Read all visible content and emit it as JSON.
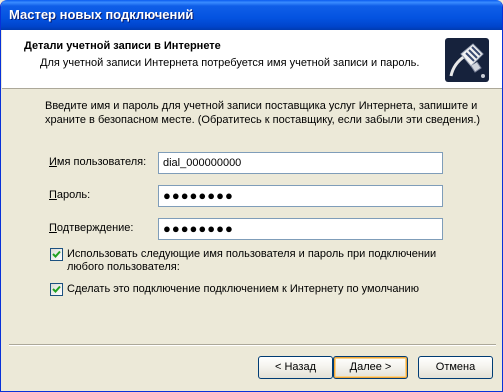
{
  "window": {
    "title": "Мастер новых подключений"
  },
  "header": {
    "title": "Детали учетной записи в Интернете",
    "subtitle": "Для учетной записи Интернета потребуется имя учетной записи и пароль."
  },
  "intro": "Введите имя и пароль для учетной записи поставщика услуг Интернета, запишите и храните в безопасном месте. (Обратитесь к поставщику, если забыли эти сведения.)",
  "form": {
    "username_label": "Имя пользователя:",
    "username_value": "dial_000000000",
    "password_label": "Пароль:",
    "password_value": "●●●●●●●●",
    "confirm_label": "Подтверждение:",
    "confirm_value": "●●●●●●●●",
    "checkbox1_label": "Использовать следующие имя пользователя и пароль при подключении любого пользователя:",
    "checkbox1_checked": true,
    "checkbox2_label": "Сделать это подключение подключением к Интернету по умолчанию",
    "checkbox2_checked": true
  },
  "buttons": {
    "back": "< Назад",
    "next": "Далее >",
    "cancel": "Отмена"
  },
  "icons": {
    "header": "phone-plug-icon",
    "check": "checkmark-icon"
  },
  "colors": {
    "titlebar": "#0453e0",
    "window_bg": "#ece9d8",
    "checkmark": "#21a121",
    "default_button_glow": "#f0a73a"
  }
}
